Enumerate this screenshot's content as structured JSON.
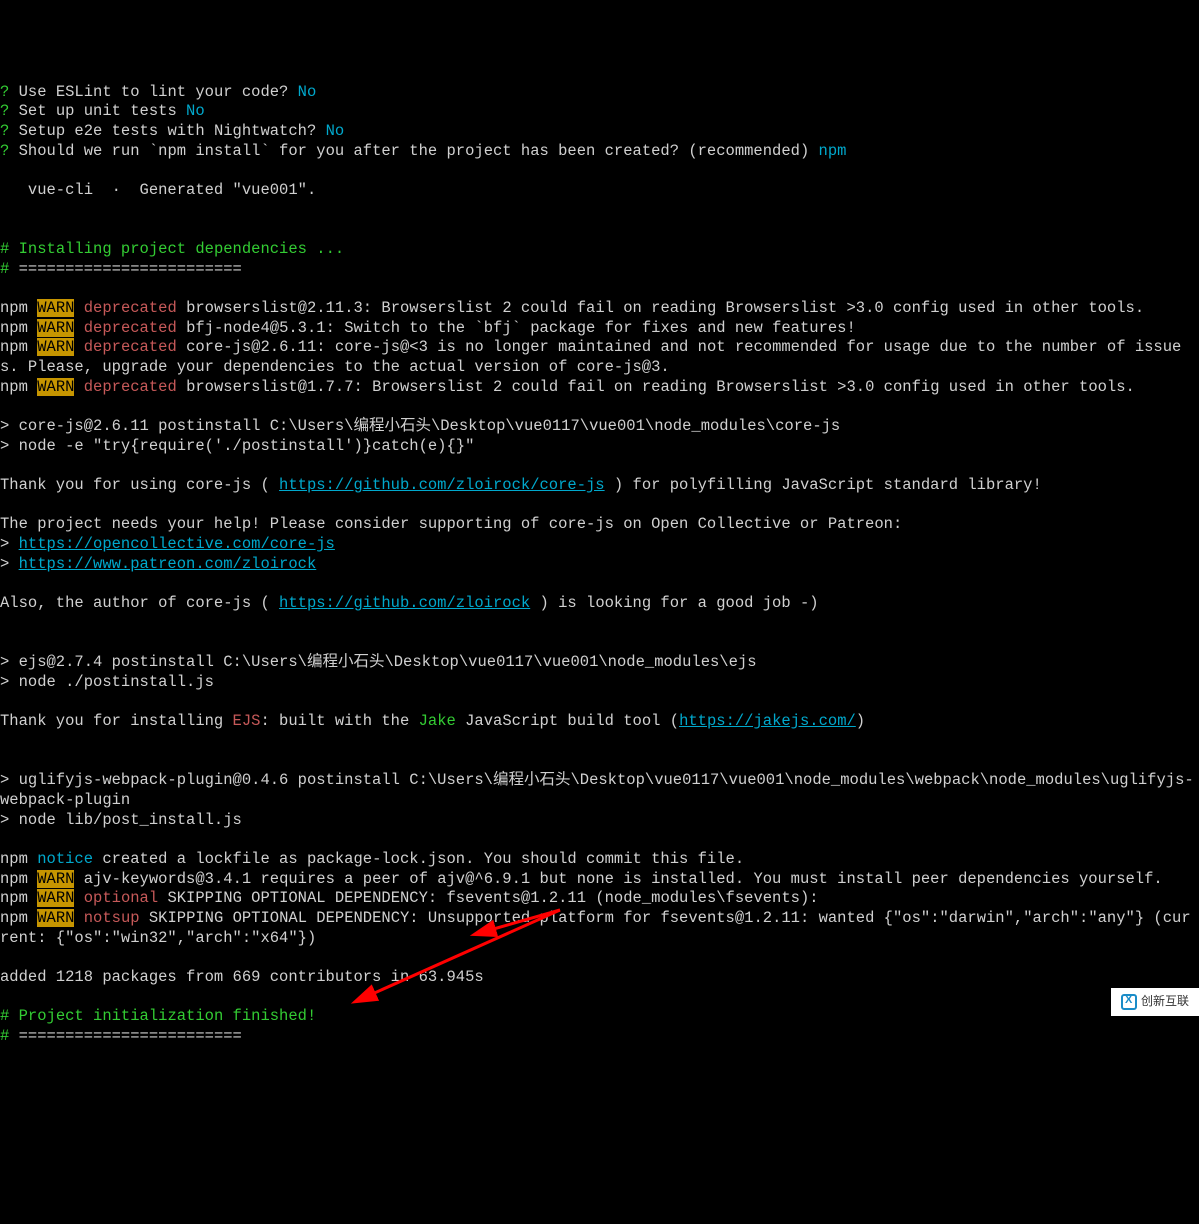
{
  "prompts": {
    "q1": {
      "mark": "?",
      "text": " Use ESLint to lint your code? ",
      "answer": "No"
    },
    "q2": {
      "mark": "?",
      "text": " Set up unit tests ",
      "answer": "No"
    },
    "q3": {
      "mark": "?",
      "text": " Setup e2e tests with Nightwatch? ",
      "answer": "No"
    },
    "q4": {
      "mark": "?",
      "text": " Should we run `npm install` for you after the project has been created? (recommended) ",
      "answer": "npm"
    }
  },
  "generated": "   vue-cli  ·  Generated \"vue001\".",
  "install_header": {
    "hash": "#",
    "text": " Installing project dependencies ..."
  },
  "install_bar": {
    "hash": "#",
    "text": " ========================"
  },
  "warn1": {
    "prefix": "npm ",
    "badge": "WARN",
    "label": " deprecated",
    "msg": " browserslist@2.11.3: Browserslist 2 could fail on reading Browserslist >3.0 config used in other tools."
  },
  "warn2": {
    "prefix": "npm ",
    "badge": "WARN",
    "label": " deprecated",
    "msg": " bfj-node4@5.3.1: Switch to the `bfj` package for fixes and new features!"
  },
  "warn3": {
    "prefix": "npm ",
    "badge": "WARN",
    "label": " deprecated",
    "msg": " core-js@2.6.11: core-js@<3 is no longer maintained and not recommended for usage due to the number of issues. Please, upgrade your dependencies to the actual version of core-js@3."
  },
  "warn4": {
    "prefix": "npm ",
    "badge": "WARN",
    "label": " deprecated",
    "msg": " browserslist@1.7.7: Browserslist 2 could fail on reading Browserslist >3.0 config used in other tools."
  },
  "post1a": "> core-js@2.6.11 postinstall C:\\Users\\编程小石头\\Desktop\\vue0117\\vue001\\node_modules\\core-js",
  "post1b": "> node -e \"try{require('./postinstall')}catch(e){}\"",
  "thank1a": "Thank you for using core-js ( ",
  "thank1url": "https://github.com/zloirock/core-js",
  "thank1b": " ) for polyfilling JavaScript standard library!",
  "help": "The project needs your help! Please consider supporting of core-js on Open Collective or Patreon:",
  "help_url1": {
    "gt": "> ",
    "url": "https://opencollective.com/core-js"
  },
  "help_url2": {
    "gt": "> ",
    "url": "https://www.patreon.com/zloirock"
  },
  "author_a": "Also, the author of core-js ( ",
  "author_url": "https://github.com/zloirock",
  "author_b": " ) is looking for a good job -)",
  "post2a": "> ejs@2.7.4 postinstall C:\\Users\\编程小石头\\Desktop\\vue0117\\vue001\\node_modules\\ejs",
  "post2b": "> node ./postinstall.js",
  "thank2a": "Thank you for installing ",
  "thank2_ejs": "EJS",
  "thank2b": ": built with the ",
  "thank2_jake": "Jake",
  "thank2c": " JavaScript build tool (",
  "thank2_url": "https://jakejs.com/",
  "thank2d": ")",
  "post3a": "> uglifyjs-webpack-plugin@0.4.6 postinstall C:\\Users\\编程小石头\\Desktop\\vue0117\\vue001\\node_modules\\webpack\\node_modules\\uglifyjs-webpack-plugin",
  "post3b": "> node lib/post_install.js",
  "notice": {
    "prefix": "npm ",
    "label": "notice",
    "msg": " created a lockfile as package-lock.json. You should commit this file."
  },
  "warn5": {
    "prefix": "npm ",
    "badge": "WARN",
    "msg": " ajv-keywords@3.4.1 requires a peer of ajv@^6.9.1 but none is installed. You must install peer dependencies yourself."
  },
  "warn6": {
    "prefix": "npm ",
    "badge": "WARN",
    "label": " optional",
    "msg": " SKIPPING OPTIONAL DEPENDENCY: fsevents@1.2.11 (node_modules\\fsevents):"
  },
  "warn7": {
    "prefix": "npm ",
    "badge": "WARN",
    "label": " notsup",
    "msg": " SKIPPING OPTIONAL DEPENDENCY: Unsupported platform for fsevents@1.2.11: wanted {\"os\":\"darwin\",\"arch\":\"any\"} (current: {\"os\":\"win32\",\"arch\":\"x64\"})"
  },
  "added": "added 1218 packages from 669 contributors in 63.945s",
  "finish_header": {
    "hash": "#",
    "text": " Project initialization finished!"
  },
  "finish_bar": {
    "hash": "#",
    "text": " ========================"
  },
  "watermark": "创新互联"
}
